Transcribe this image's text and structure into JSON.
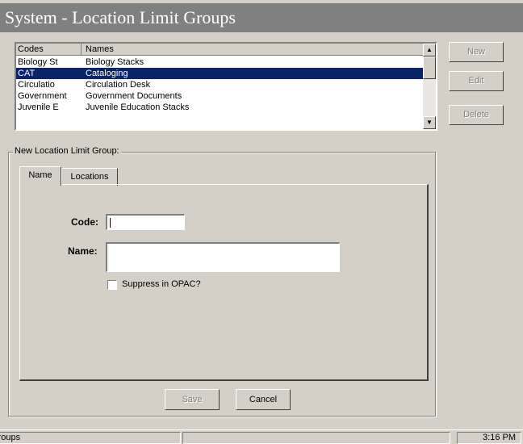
{
  "window": {
    "title": "System - Location Limit Groups"
  },
  "list": {
    "columns": [
      "Codes",
      "Names"
    ],
    "rows": [
      {
        "code": "Biology St",
        "name": "Biology Stacks",
        "selected": false
      },
      {
        "code": "CAT",
        "name": "Cataloging",
        "selected": true
      },
      {
        "code": "Circulatio",
        "name": "Circulation Desk",
        "selected": false
      },
      {
        "code": "Government",
        "name": "Government Documents",
        "selected": false
      },
      {
        "code": "Juvenile E",
        "name": "Juvenile Education Stacks",
        "selected": false
      }
    ]
  },
  "buttons": {
    "new": "New",
    "edit": "Edit",
    "delete": "Delete",
    "save": "Save",
    "cancel": "Cancel"
  },
  "form": {
    "group_label": "New  Location Limit Group:",
    "tabs": [
      "Name",
      "Locations"
    ],
    "code_label": "Code:",
    "code_value": "",
    "name_label": "Name:",
    "name_value": "",
    "suppress_label": "Suppress in OPAC?",
    "suppress_checked": false
  },
  "status": {
    "left": "Groups",
    "time": "3:16 PM"
  },
  "colors": {
    "title_bar": "#808080",
    "selection": "#0a246a",
    "face": "#d4d0c8"
  }
}
